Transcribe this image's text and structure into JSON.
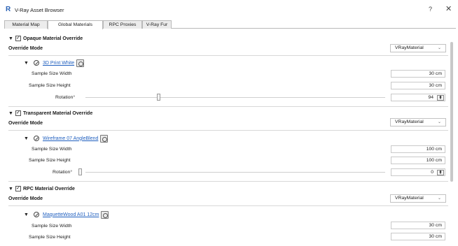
{
  "window": {
    "title": "V-Ray Asset Browser",
    "help_label": "?",
    "close_label": "✕"
  },
  "tabs": [
    {
      "label": "Material Map"
    },
    {
      "label": "Global Materials"
    },
    {
      "label": "RPC Proxies"
    },
    {
      "label": "V-Ray Fur"
    }
  ],
  "sections": [
    {
      "title": "Opaque Material Override",
      "checked": true,
      "override_mode_label": "Override Mode",
      "override_mode_value": "VRayMaterial",
      "material_name": "3D Print White",
      "width_label": "Sample Size Width",
      "width_value": "30 cm",
      "height_label": "Sample Size Height",
      "height_value": "30 cm",
      "rotation_label": "Rotation°",
      "rotation_value": "94"
    },
    {
      "title": "Transparent Material Override",
      "checked": true,
      "override_mode_label": "Override Mode",
      "override_mode_value": "VRayMaterial",
      "material_name": "Wireframe 07 AngleBlend",
      "width_label": "Sample Size Width",
      "width_value": "100 cm",
      "height_label": "Sample Size Height",
      "height_value": "100 cm",
      "rotation_label": "Rotation°",
      "rotation_value": "0"
    },
    {
      "title": "RPC Material Override",
      "checked": true,
      "override_mode_label": "Override Mode",
      "override_mode_value": "VRayMaterial",
      "material_name": "MaquetteWood A01 12cm",
      "width_label": "Sample Size Width",
      "width_value": "30 cm",
      "height_label": "Sample Size Height",
      "height_value": "30 cm"
    }
  ],
  "icons": {
    "expand": "triangle-down-icon",
    "material": "material-circle-icon",
    "picker": "material-picker-icon",
    "dropdown": "chevron-down-icon"
  },
  "colors": {
    "link": "#1f5fbf",
    "app_icon": "#2b63b6"
  }
}
